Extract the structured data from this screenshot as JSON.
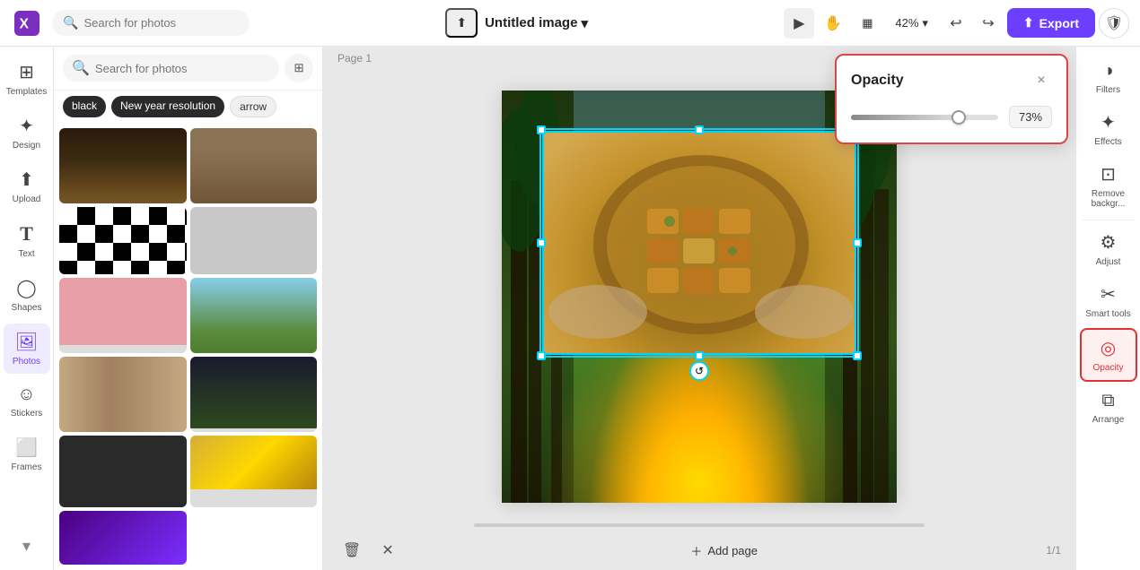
{
  "header": {
    "logo_label": "Canva",
    "search_placeholder": "Search for photos",
    "doc_title": "Untitled image",
    "doc_title_arrow": "▾",
    "zoom_level": "42%",
    "export_label": "Export",
    "upload_icon": "⬆",
    "undo_icon": "↩",
    "redo_icon": "↪",
    "chevron_icon": "▾",
    "shield_icon": "🛡",
    "select_tool_icon": "▶",
    "hand_tool_icon": "✋",
    "layout_icon": "▦"
  },
  "photo_panel": {
    "search_placeholder": "Search for photos",
    "tags": [
      "black",
      "New year resolution",
      "arrow"
    ],
    "filter_icon": "⊞"
  },
  "canvas": {
    "page_label": "Page 1",
    "floating_toolbar": {
      "crop_icon": "⊡",
      "grid_icon": "⊞",
      "replace_icon": "⊟",
      "more_icon": "•••"
    },
    "rotate_icon": "↺",
    "add_page_label": "Add page",
    "page_count": "1/1"
  },
  "opacity_panel": {
    "title": "Opacity",
    "close_icon": "×",
    "value": "73%",
    "slider_percent": 73
  },
  "left_sidebar": {
    "items": [
      {
        "id": "templates",
        "label": "Templates",
        "icon": "⊞"
      },
      {
        "id": "design",
        "label": "Design",
        "icon": "✦"
      },
      {
        "id": "upload",
        "label": "Upload",
        "icon": "⬆"
      },
      {
        "id": "text",
        "label": "Text",
        "icon": "T"
      },
      {
        "id": "shapes",
        "label": "Shapes",
        "icon": "◯"
      },
      {
        "id": "photos",
        "label": "Photos",
        "icon": "🖼"
      },
      {
        "id": "stickers",
        "label": "Stickers",
        "icon": "☺"
      },
      {
        "id": "frames",
        "label": "Frames",
        "icon": "⬜"
      }
    ]
  },
  "right_sidebar": {
    "items": [
      {
        "id": "filters",
        "label": "Filters",
        "icon": "◑"
      },
      {
        "id": "effects",
        "label": "Effects",
        "icon": "✦"
      },
      {
        "id": "remove-bg",
        "label": "Remove backgr...",
        "icon": "⊡"
      },
      {
        "id": "adjust",
        "label": "Adjust",
        "icon": "⚙"
      },
      {
        "id": "smart-tools",
        "label": "Smart tools",
        "icon": "✂"
      },
      {
        "id": "opacity",
        "label": "Opacity",
        "icon": "◎",
        "active": true
      },
      {
        "id": "arrange",
        "label": "Arrange",
        "icon": "⧉"
      }
    ]
  }
}
